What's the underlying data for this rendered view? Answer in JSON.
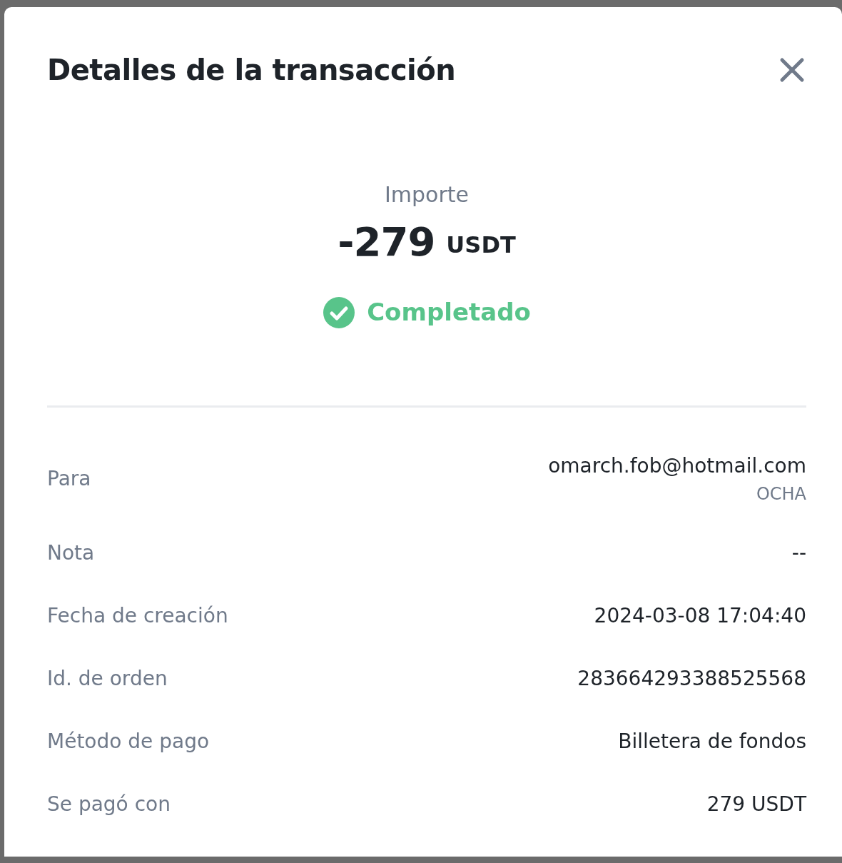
{
  "dialog": {
    "title": "Detalles de la transacción"
  },
  "amount": {
    "label": "Importe",
    "value": "-279",
    "currency": "USDT"
  },
  "status": {
    "kind": "completed",
    "label": "Completado"
  },
  "details": [
    {
      "label": "Para",
      "value": "omarch.fob@hotmail.com",
      "sub_value": "OCHA"
    },
    {
      "label": "Nota",
      "value": "--"
    },
    {
      "label": "Fecha de creación",
      "value": "2024-03-08 17:04:40"
    },
    {
      "label": "Id. de orden",
      "value": "283664293388525568"
    },
    {
      "label": "Método de pago",
      "value": "Billetera de fondos"
    },
    {
      "label": "Se pagó con",
      "value": "279 USDT"
    }
  ]
}
